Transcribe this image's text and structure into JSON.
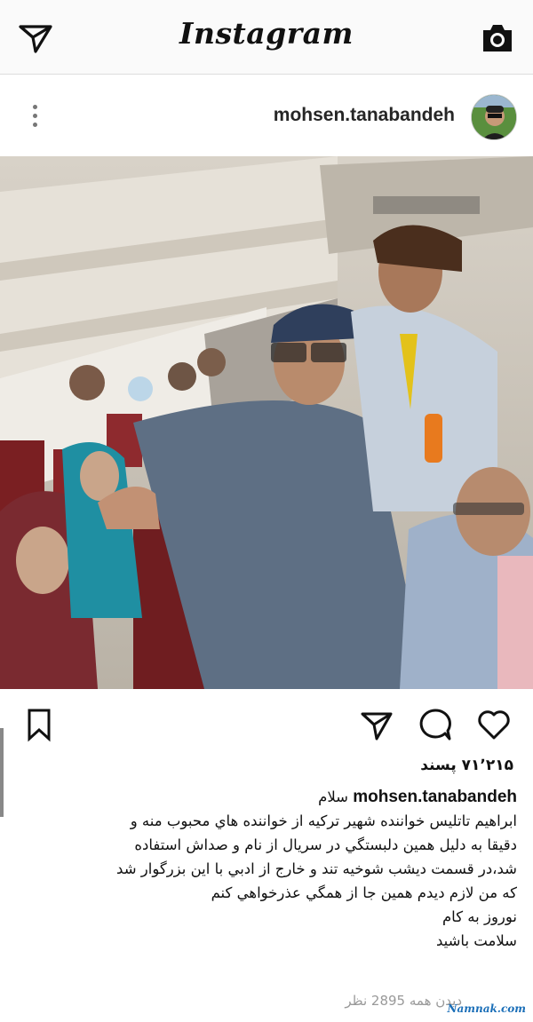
{
  "header": {
    "app_title": "Instagram",
    "left_icon": "send-icon",
    "right_icon": "camera-icon"
  },
  "post": {
    "username": "mohsen.tanabandeh",
    "more_icon": "more-vertical-icon",
    "photo_description_icon": "airplane-cabin-photo",
    "likes": "۷۱٬۲۱۵ پسند",
    "caption_username": "mohsen.tanabandeh",
    "caption_lines": [
      "سلام",
      "ابراهيم تاتليس خواننده شهير تركيه از خواننده هاي محبوب منه و",
      "دقيقا به دليل همين دلبستگي در سريال از نام و صداش استفاده",
      "شد،در قسمت ديشب شوخيه تند و خارج از ادبي با اين بزرگوار شد",
      "كه من لازم ديدم همين جا از همگي عذرخواهي كنم",
      "نوروز به كام",
      "سلامت باشيد"
    ],
    "views": "ديدن همه 2895 نظر"
  },
  "actions": {
    "bookmark": "bookmark-icon",
    "share": "send-icon",
    "comment": "comment-icon",
    "like": "heart-icon"
  },
  "watermark": "Namnak.com",
  "colors": {
    "topbar_bg": "#fafafa",
    "text": "#111111",
    "muted": "#999999",
    "watermark": "#1b6fb8"
  }
}
